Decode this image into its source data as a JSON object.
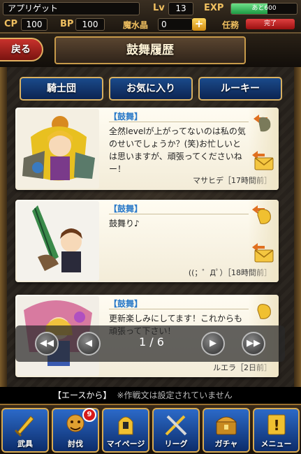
{
  "status": {
    "player_name": "アプリゲット",
    "lv_label": "Lv",
    "lv": "13",
    "exp_label": "EXP",
    "exp_text": "あと600",
    "exp_fraction": 0.55,
    "cp_label": "CP",
    "cp": "100",
    "bp_label": "BP",
    "bp": "100",
    "gem_label": "魔水晶",
    "gem": "0",
    "gem_plus": "+",
    "task_label": "任務",
    "task_status": "完了"
  },
  "header": {
    "back_label": "戻る",
    "title": "鼓舞履歴"
  },
  "tabs": [
    {
      "label": "騎士団"
    },
    {
      "label": "お気に入り"
    },
    {
      "label": "ルーキー"
    }
  ],
  "cards": [
    {
      "tag": "【鼓舞】",
      "message": "全然levelが上がってないのは私の気のせいでしょうか？(笑)お忙しいとは思いますが、頑張ってくださいねー！",
      "meta": "マサヒデ［17時間前］"
    },
    {
      "tag": "【鼓舞】",
      "message": "鼓舞り♪",
      "meta": "((；゜Дﾟ）［18時間前］"
    },
    {
      "tag": "【鼓舞】",
      "message": "更新楽しみにしてます！これからも頑張って下さい！",
      "meta": "ルエラ［2日前］"
    }
  ],
  "pager": {
    "text": "1 / 6"
  },
  "ace": {
    "label": "【エースから】",
    "text": "※作戦文は設定されていません"
  },
  "nav": [
    {
      "label": "武具",
      "icon": "weapon-icon"
    },
    {
      "label": "討伐",
      "icon": "battle-icon",
      "badge": "9"
    },
    {
      "label": "マイページ",
      "icon": "mypage-icon"
    },
    {
      "label": "リーグ",
      "icon": "league-icon"
    },
    {
      "label": "ガチャ",
      "icon": "gacha-icon"
    },
    {
      "label": "メニュー",
      "icon": "menu-icon"
    }
  ],
  "colors": {
    "accent_gold": "#d8b060",
    "tab_blue": "#1a4a8a",
    "back_red": "#c8322c",
    "tag_blue": "#2a7ac8",
    "exp_green": "#1d9a43"
  }
}
